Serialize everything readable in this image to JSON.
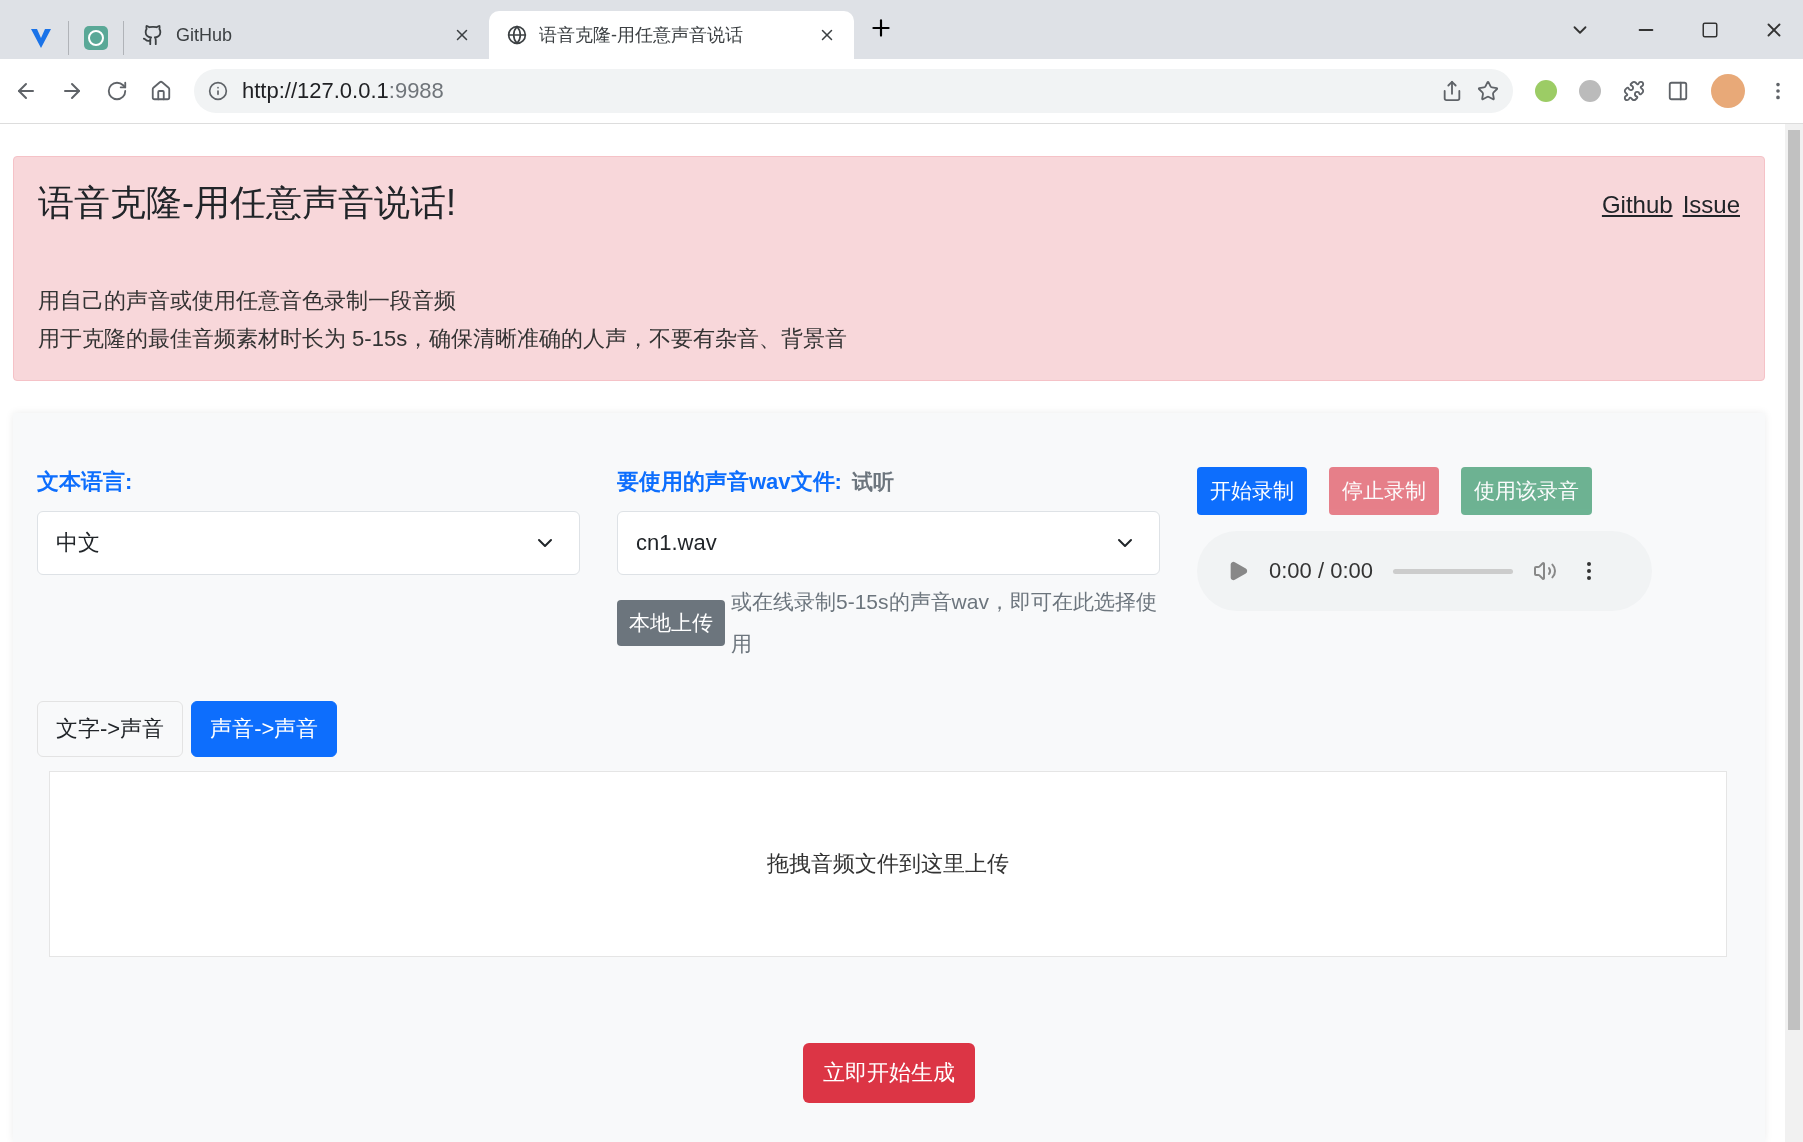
{
  "browser": {
    "tabs": [
      {
        "title": "GitHub",
        "selected": false
      },
      {
        "title": "语音克隆-用任意声音说话",
        "selected": true
      }
    ],
    "address": {
      "host": "http://127.0.0.1",
      "port": ":9988"
    }
  },
  "header": {
    "title": "语音克隆-用任意声音说话!",
    "links": [
      "Github",
      "Issue"
    ],
    "lines": [
      "用自己的声音或使用任意音色录制一段音频",
      "用于克隆的最佳音频素材时长为 5-15s，确保清晰准确的人声，不要有杂音、背景音"
    ]
  },
  "language": {
    "label": "文本语言:",
    "value": "中文"
  },
  "voice": {
    "label": "要使用的声音wav文件:",
    "preview_link": "试听",
    "value": "cn1.wav",
    "upload_button": "本地上传",
    "hint": "或在线录制5-15s的声音wav，即可在此选择使用"
  },
  "record_buttons": [
    {
      "label": "开始录制",
      "kind": "start",
      "disabled": false
    },
    {
      "label": "停止录制",
      "kind": "stop",
      "disabled": true
    },
    {
      "label": "使用该录音",
      "kind": "use",
      "disabled": true
    }
  ],
  "audio_player": {
    "time": "0:00 / 0:00"
  },
  "mode_tabs": [
    {
      "label": "文字->声音",
      "selected": false
    },
    {
      "label": "声音->声音",
      "selected": true
    }
  ],
  "dropzone": {
    "text": "拖拽音频文件到这里上传"
  },
  "generate_button": "立即开始生成"
}
